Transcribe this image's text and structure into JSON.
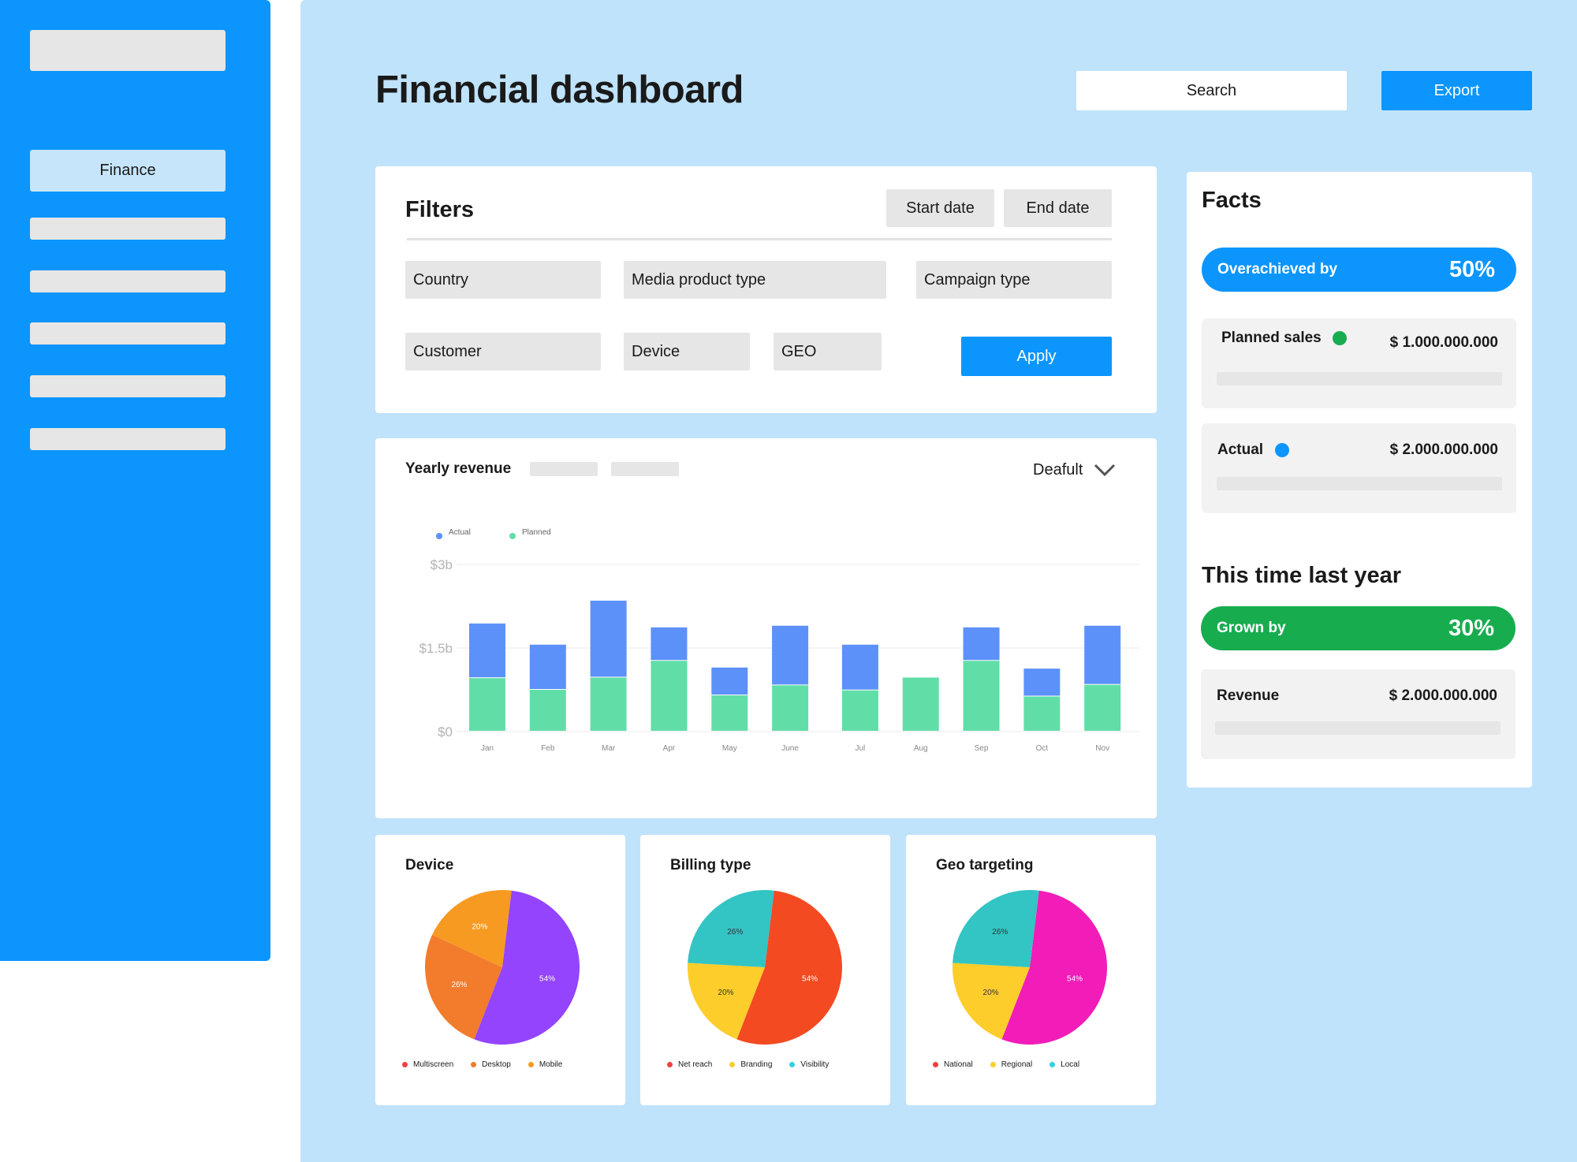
{
  "sidebar": {
    "items": [
      {
        "label": "Finance",
        "active": true
      }
    ]
  },
  "header": {
    "title": "Financial dashboard",
    "search_placeholder": "Search",
    "export_label": "Export"
  },
  "filters": {
    "title": "Filters",
    "start_date": "Start date",
    "end_date": "End date",
    "country": "Country",
    "media_product_type": "Media product type",
    "campaign_type": "Campaign type",
    "customer": "Customer",
    "device": "Device",
    "geo": "GEO",
    "apply_label": "Apply"
  },
  "revenue": {
    "title": "Yearly revenue",
    "period": "Deafult"
  },
  "facts": {
    "title": "Facts",
    "overachieved": {
      "label": "Overachieved by",
      "value": "50%",
      "color": "#0c95fd"
    },
    "planned_sales": {
      "label": "Planned sales",
      "value": "$ 1.000.000.000",
      "dot_color": "#17ad4f"
    },
    "actual": {
      "label": "Actual",
      "value": "$ 2.000.000.000",
      "dot_color": "#0c95fd"
    },
    "last_year_title": "This time last year",
    "grown": {
      "label": "Grown by",
      "value": "30%",
      "color": "#17ad4f"
    },
    "revenue": {
      "label": "Revenue",
      "value": "$ 2.000.000.000"
    }
  },
  "pies": [
    {
      "title": "Device",
      "slices": [
        {
          "label": "54%",
          "value": 54,
          "color": "#9444fc"
        },
        {
          "label": "26%",
          "value": 26,
          "color": "#f37b2c"
        },
        {
          "label": "20%",
          "value": 20,
          "color": "#f79a22"
        }
      ],
      "legend": [
        {
          "label": "Multiscreen",
          "color": "#f2413f"
        },
        {
          "label": "Desktop",
          "color": "#f37b2c"
        },
        {
          "label": "Mobile",
          "color": "#f79a22"
        }
      ]
    },
    {
      "title": "Billing type",
      "slices": [
        {
          "label": "54%",
          "value": 54,
          "color": "#f34a22"
        },
        {
          "label": "20%",
          "value": 20,
          "color": "#fdcd2b"
        },
        {
          "label": "26%",
          "value": 26,
          "color": "#33c4c4"
        }
      ],
      "legend": [
        {
          "label": "Net reach",
          "color": "#f2413f"
        },
        {
          "label": "Branding",
          "color": "#fdcd2b"
        },
        {
          "label": "Visibility",
          "color": "#33d0e9"
        }
      ]
    },
    {
      "title": "Geo targeting",
      "slices": [
        {
          "label": "54%",
          "value": 54,
          "color": "#f21cb8"
        },
        {
          "label": "20%",
          "value": 20,
          "color": "#fdcd2b"
        },
        {
          "label": "26%",
          "value": 26,
          "color": "#33c4c4"
        }
      ],
      "legend": [
        {
          "label": "National",
          "color": "#f2413f"
        },
        {
          "label": "Regional",
          "color": "#fdcd2b"
        },
        {
          "label": "Local",
          "color": "#33d0e9"
        }
      ]
    }
  ],
  "chart_data": {
    "type": "bar",
    "stacked": true,
    "title": "Yearly revenue",
    "categories": [
      "Jan",
      "Feb",
      "Mar",
      "Apr",
      "May",
      "June",
      "Jul",
      "Aug",
      "Sep",
      "Oct",
      "Nov"
    ],
    "series": [
      {
        "name": "Planned",
        "color": "#61dea8",
        "values": [
          0.96,
          0.75,
          0.97,
          1.27,
          0.65,
          0.83,
          0.74,
          0.97,
          1.27,
          0.63,
          0.84
        ]
      },
      {
        "name": "Actual",
        "color": "#5c91f9",
        "values": [
          0.98,
          0.81,
          1.38,
          0.6,
          0.5,
          1.07,
          0.82,
          0,
          0.6,
          0.5,
          1.06
        ]
      }
    ],
    "yticks": [
      "$0",
      "$1.5b",
      "$3b"
    ],
    "ylim": [
      0,
      3
    ],
    "grid": true,
    "legend_position": "top-left"
  }
}
